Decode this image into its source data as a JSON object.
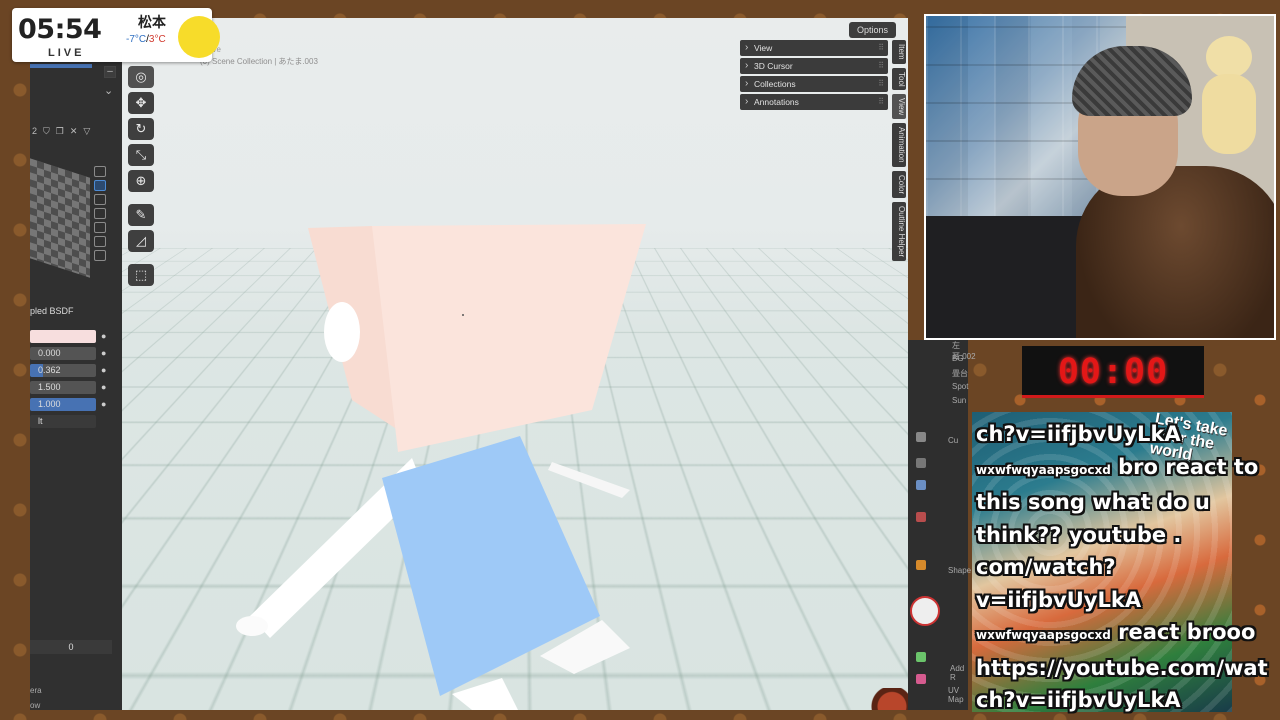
{
  "clock": {
    "time": "05:54",
    "live": "LIVE",
    "city": "松本",
    "temp_low": "-7°C",
    "temp_sep": "/",
    "temp_high": "3°C"
  },
  "blender": {
    "viewport": {
      "title_line1": "ective",
      "title_line2": "(0) Scene Collection | あたま.003",
      "options_label": "Options",
      "npanel": [
        "View",
        "3D Cursor",
        "Collections",
        "Annotations"
      ],
      "tabs": [
        "Item",
        "Tool",
        "View",
        "Animation",
        "Color",
        "Outline Helper"
      ]
    },
    "left_panel": {
      "row_number": "2",
      "shader_label": "pled BSDF",
      "fields": [
        "",
        "0.000",
        "0.362",
        "1.500",
        "1.000"
      ],
      "field_label_it": "lt",
      "bottom_value": "0",
      "bottom_label1": "era",
      "bottom_label2": "ow"
    },
    "outliner": [
      "左耳.002",
      "BG",
      "畳台",
      "Spot",
      "Sun"
    ],
    "properties": [
      "Cu",
      "Shape",
      "Add R",
      "UV Map"
    ]
  },
  "timer": {
    "value": "00:00"
  },
  "chat_art_tag": "Let's take over the world",
  "chat": [
    {
      "text": "ch?v=iifjbvUyLkA"
    },
    {
      "user": "wxwfwqyaapsgocxd",
      "text": " bro react to"
    },
    {
      "text": "this song what do u"
    },
    {
      "text": "think?? youtube ."
    },
    {
      "text": "com/watch?"
    },
    {
      "text": "v=iifjbvUyLkA"
    },
    {
      "user": "wxwfwqyaapsgocxd",
      "text": " react brooo"
    },
    {
      "text": "https://youtube.com/wat"
    },
    {
      "text": "ch?v=iifjbvUyLkA"
    }
  ]
}
